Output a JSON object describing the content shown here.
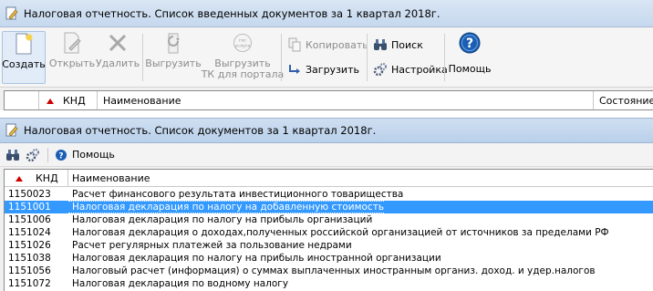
{
  "window1": {
    "title": "Налоговая отчетность. Список введенных документов за 1 квартал 2018г."
  },
  "toolbar": {
    "create": "Создать",
    "open": "Открыть",
    "delete": "Удалить",
    "export": "Выгрузить",
    "export_tk_line1": "Выгрузить",
    "export_tk_line2": "ТК для портала",
    "gos_icon_text_1": "гос",
    "gos_icon_text_2": "услуги",
    "copy": "Копировать",
    "load": "Загрузить",
    "search": "Поиск",
    "settings": "Настройка",
    "help": "Помощь"
  },
  "grid1": {
    "columns": [
      "КНД",
      "Наименование",
      "Состояние"
    ]
  },
  "window2": {
    "title": "Налоговая отчетность. Список документов за 1 квартал 2018г.",
    "help": "Помощь"
  },
  "grid2": {
    "columns": [
      "КНД",
      "Наименование"
    ],
    "rows": [
      {
        "code": "1150023",
        "name": "Расчет финансового результата инвестиционного товарищества"
      },
      {
        "code": "1151001",
        "name": "Налоговая декларация по налогу на добавленную стоимость"
      },
      {
        "code": "1151006",
        "name": "Налоговая декларация по налогу на прибыль организаций"
      },
      {
        "code": "1151024",
        "name": "Налоговая декларация о доходах,полученных российской организацией от источников за пределами РФ"
      },
      {
        "code": "1151026",
        "name": "Расчет регулярных платежей за пользование недрами"
      },
      {
        "code": "1151038",
        "name": "Налоговая декларация по налогу на прибыль иностранной организации"
      },
      {
        "code": "1151056",
        "name": "Налоговый расчет (информация) о суммах выплаченных иностранным организ. доход. и удер.налогов"
      },
      {
        "code": "1151072",
        "name": "Налоговая декларация по водному налогу"
      }
    ],
    "selected_index": 1
  },
  "colors": {
    "selection": "#3399ff",
    "title_bar": "#c5d8ee",
    "sort_arrow": "#cc0000",
    "help_icon": "#1a5fb4"
  }
}
